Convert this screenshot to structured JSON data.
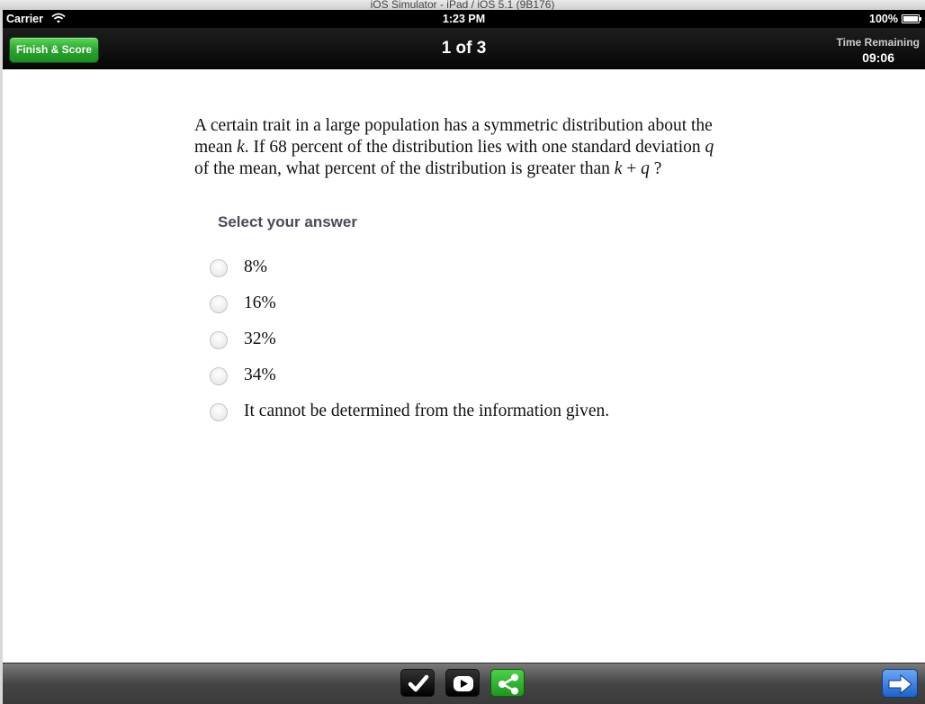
{
  "simulator": {
    "title": "iOS Simulator - iPad / iOS 5.1 (9B176)"
  },
  "status_bar": {
    "carrier": "Carrier",
    "time": "1:23 PM",
    "battery": "100%"
  },
  "nav_bar": {
    "finish_label": "Finish & Score",
    "counter": "1 of 3",
    "time_label": "Time Remaining",
    "time_value": "09:06"
  },
  "question": {
    "line1": "A certain trait in a large population has a symmetric distribution about the",
    "line2_pre": "mean ",
    "var_k": "k",
    "line2_mid": ".  If 68 percent of the distribution lies with one standard deviation ",
    "var_q": "q",
    "line3_pre": "of the mean, what percent of the distribution is greater than ",
    "plus": " + ",
    "line3_post": " ?"
  },
  "answers": {
    "prompt": "Select your answer",
    "options": [
      "8%",
      "16%",
      "32%",
      "34%",
      "It cannot be determined from the information given."
    ]
  },
  "toolbar": {
    "icons": [
      "checkmark-icon",
      "video-play-icon",
      "share-icon",
      "next-arrow-icon"
    ]
  }
}
